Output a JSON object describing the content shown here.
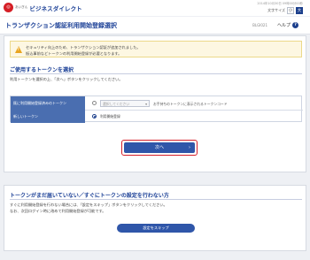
{
  "header": {
    "logo_small": "あいぎん",
    "logo_main": "ビジネスダイレクト",
    "datetime": "2014年10月30日 09時00分00秒",
    "font_size_label": "文字サイズ",
    "font_small": "小",
    "font_large": "大"
  },
  "title_bar": {
    "title": "トランザクション認証利用開始登録選択",
    "screen_id": "BLGI021",
    "help_label": "ヘルプ",
    "help_icon_glyph": "?"
  },
  "notice": {
    "line1": "セキュリティ向上のため、トランザクション認証が追加されました。",
    "line2": "振込事前などトークンの利用開始登録が必要となります。"
  },
  "token_section": {
    "heading": "ご使用するトークンを選択",
    "description": "利用トークンを選択の上、「次へ」ボタンをクリックしてください。",
    "rows": [
      {
        "label": "既に利用開始登録済みのトークン",
        "select_placeholder": "選択してください",
        "select_arrow": "▾",
        "note": "お手持ちのトークンに表示されるトークンコード",
        "selected": false
      },
      {
        "label": "新しいトークン",
        "option_text": "利用開始登録",
        "selected": true
      }
    ],
    "next_button": "次へ",
    "next_arrow": "›"
  },
  "skip_section": {
    "heading": "トークンがまだ届いていない／すぐにトークンの設定を行わない方",
    "line1": "すぐに利用開始登録を行わない場合には、「設定をスキップ」ボタンをクリックしてください。",
    "line2": "なお、次回ログイン時に改めて利用開始登録が可能です。",
    "skip_button": "設定をスキップ"
  },
  "colors": {
    "brand_blue": "#1a3f96",
    "button_blue": "#2f56a9",
    "focus_red": "#d41f2a",
    "warning_amber": "#e9a51f"
  }
}
